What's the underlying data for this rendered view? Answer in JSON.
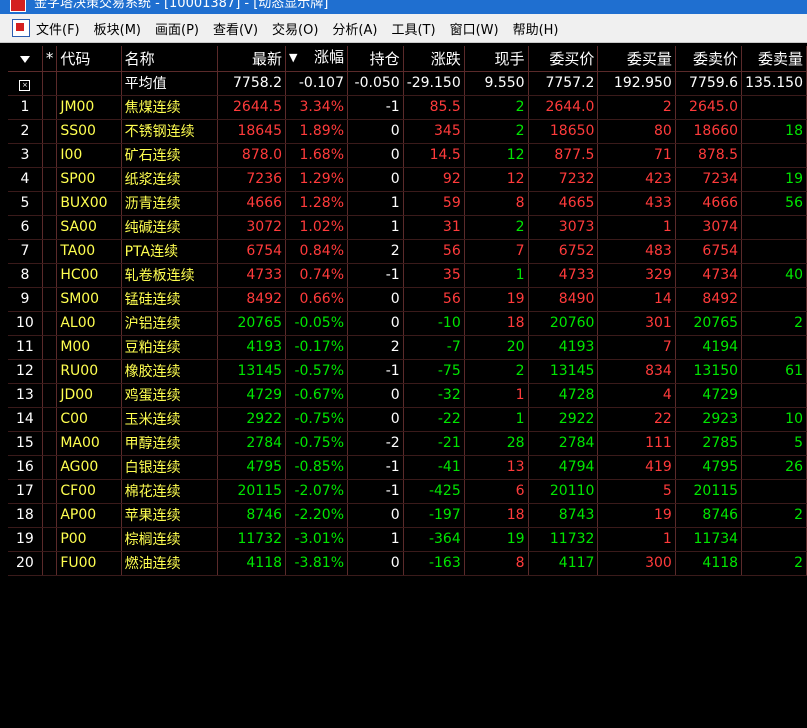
{
  "window": {
    "title": "金字塔决策交易系统 - [10001387] - [动态显示牌]"
  },
  "menu": [
    "文件(F)",
    "板块(M)",
    "画面(P)",
    "查看(V)",
    "交易(O)",
    "分析(A)",
    "工具(T)",
    "窗口(W)",
    "帮助(H)"
  ],
  "table": {
    "headers": {
      "star": "*",
      "code": "代码",
      "name": "名称",
      "last": "最新",
      "pct": "涨幅",
      "oi": "持仓",
      "chg": "涨跌",
      "vol": "现手",
      "bid": "委买价",
      "bidvol": "委买量",
      "ask": "委卖价",
      "askvol": "委卖量"
    },
    "sort_indicator": "▼",
    "average": {
      "name": "平均值",
      "last": "7758.2",
      "pct": "-0.107",
      "oi": "-0.050",
      "chg": "-29.150",
      "vol": "9.550",
      "bid": "7757.2",
      "bidvol": "192.950",
      "ask": "7759.6",
      "askvol": "135.150"
    },
    "rows": [
      {
        "idx": "1",
        "code": "JM00",
        "name": "焦煤连续",
        "last": "2644.5",
        "pct": "3.34%",
        "oi": "-1",
        "chg": "85.5",
        "vol": "2",
        "bid": "2644.0",
        "bidvol": "2",
        "ask": "2645.0",
        "askvol": ""
      },
      {
        "idx": "2",
        "code": "SS00",
        "name": "不锈钢连续",
        "last": "18645",
        "pct": "1.89%",
        "oi": "0",
        "chg": "345",
        "vol": "2",
        "bid": "18650",
        "bidvol": "80",
        "ask": "18660",
        "askvol": "18"
      },
      {
        "idx": "3",
        "code": "I00",
        "name": "矿石连续",
        "last": "878.0",
        "pct": "1.68%",
        "oi": "0",
        "chg": "14.5",
        "vol": "12",
        "bid": "877.5",
        "bidvol": "71",
        "ask": "878.5",
        "askvol": ""
      },
      {
        "idx": "4",
        "code": "SP00",
        "name": "纸浆连续",
        "last": "7236",
        "pct": "1.29%",
        "oi": "0",
        "chg": "92",
        "vol": "12",
        "bid": "7232",
        "bidvol": "423",
        "ask": "7234",
        "askvol": "19"
      },
      {
        "idx": "5",
        "code": "BUX00",
        "name": "沥青连续",
        "last": "4666",
        "pct": "1.28%",
        "oi": "1",
        "chg": "59",
        "vol": "8",
        "bid": "4665",
        "bidvol": "433",
        "ask": "4666",
        "askvol": "56"
      },
      {
        "idx": "6",
        "code": "SA00",
        "name": "纯碱连续",
        "last": "3072",
        "pct": "1.02%",
        "oi": "1",
        "chg": "31",
        "vol": "2",
        "bid": "3073",
        "bidvol": "1",
        "ask": "3074",
        "askvol": ""
      },
      {
        "idx": "7",
        "code": "TA00",
        "name": "PTA连续",
        "last": "6754",
        "pct": "0.84%",
        "oi": "2",
        "chg": "56",
        "vol": "7",
        "bid": "6752",
        "bidvol": "483",
        "ask": "6754",
        "askvol": ""
      },
      {
        "idx": "8",
        "code": "HC00",
        "name": "轧卷板连续",
        "last": "4733",
        "pct": "0.74%",
        "oi": "-1",
        "chg": "35",
        "vol": "1",
        "bid": "4733",
        "bidvol": "329",
        "ask": "4734",
        "askvol": "40"
      },
      {
        "idx": "9",
        "code": "SM00",
        "name": "锰硅连续",
        "last": "8492",
        "pct": "0.66%",
        "oi": "0",
        "chg": "56",
        "vol": "19",
        "bid": "8490",
        "bidvol": "14",
        "ask": "8492",
        "askvol": ""
      },
      {
        "idx": "10",
        "code": "AL00",
        "name": "沪铝连续",
        "last": "20765",
        "pct": "-0.05%",
        "oi": "0",
        "chg": "-10",
        "vol": "18",
        "bid": "20760",
        "bidvol": "301",
        "ask": "20765",
        "askvol": "2"
      },
      {
        "idx": "11",
        "code": "M00",
        "name": "豆粕连续",
        "last": "4193",
        "pct": "-0.17%",
        "oi": "2",
        "chg": "-7",
        "vol": "20",
        "bid": "4193",
        "bidvol": "7",
        "ask": "4194",
        "askvol": ""
      },
      {
        "idx": "12",
        "code": "RU00",
        "name": "橡胶连续",
        "last": "13145",
        "pct": "-0.57%",
        "oi": "-1",
        "chg": "-75",
        "vol": "2",
        "bid": "13145",
        "bidvol": "834",
        "ask": "13150",
        "askvol": "61"
      },
      {
        "idx": "13",
        "code": "JD00",
        "name": "鸡蛋连续",
        "last": "4729",
        "pct": "-0.67%",
        "oi": "0",
        "chg": "-32",
        "vol": "1",
        "bid": "4728",
        "bidvol": "4",
        "ask": "4729",
        "askvol": ""
      },
      {
        "idx": "14",
        "code": "C00",
        "name": "玉米连续",
        "last": "2922",
        "pct": "-0.75%",
        "oi": "0",
        "chg": "-22",
        "vol": "1",
        "bid": "2922",
        "bidvol": "22",
        "ask": "2923",
        "askvol": "10"
      },
      {
        "idx": "15",
        "code": "MA00",
        "name": "甲醇连续",
        "last": "2784",
        "pct": "-0.75%",
        "oi": "-2",
        "chg": "-21",
        "vol": "28",
        "bid": "2784",
        "bidvol": "111",
        "ask": "2785",
        "askvol": "5"
      },
      {
        "idx": "16",
        "code": "AG00",
        "name": "白银连续",
        "last": "4795",
        "pct": "-0.85%",
        "oi": "-1",
        "chg": "-41",
        "vol": "13",
        "bid": "4794",
        "bidvol": "419",
        "ask": "4795",
        "askvol": "26"
      },
      {
        "idx": "17",
        "code": "CF00",
        "name": "棉花连续",
        "last": "20115",
        "pct": "-2.07%",
        "oi": "-1",
        "chg": "-425",
        "vol": "6",
        "bid": "20110",
        "bidvol": "5",
        "ask": "20115",
        "askvol": ""
      },
      {
        "idx": "18",
        "code": "AP00",
        "name": "苹果连续",
        "last": "8746",
        "pct": "-2.20%",
        "oi": "0",
        "chg": "-197",
        "vol": "18",
        "bid": "8743",
        "bidvol": "19",
        "ask": "8746",
        "askvol": "2"
      },
      {
        "idx": "19",
        "code": "P00",
        "name": "棕榈连续",
        "last": "11732",
        "pct": "-3.01%",
        "oi": "1",
        "chg": "-364",
        "vol": "19",
        "bid": "11732",
        "bidvol": "1",
        "ask": "11734",
        "askvol": ""
      },
      {
        "idx": "20",
        "code": "FU00",
        "name": "燃油连续",
        "last": "4118",
        "pct": "-3.81%",
        "oi": "0",
        "chg": "-163",
        "vol": "8",
        "bid": "4117",
        "bidvol": "300",
        "ask": "4118",
        "askvol": "2"
      }
    ]
  },
  "colors": {
    "up": "#ff3b3b",
    "down": "#00e600",
    "label": "#ffff50",
    "background": "#000000"
  }
}
